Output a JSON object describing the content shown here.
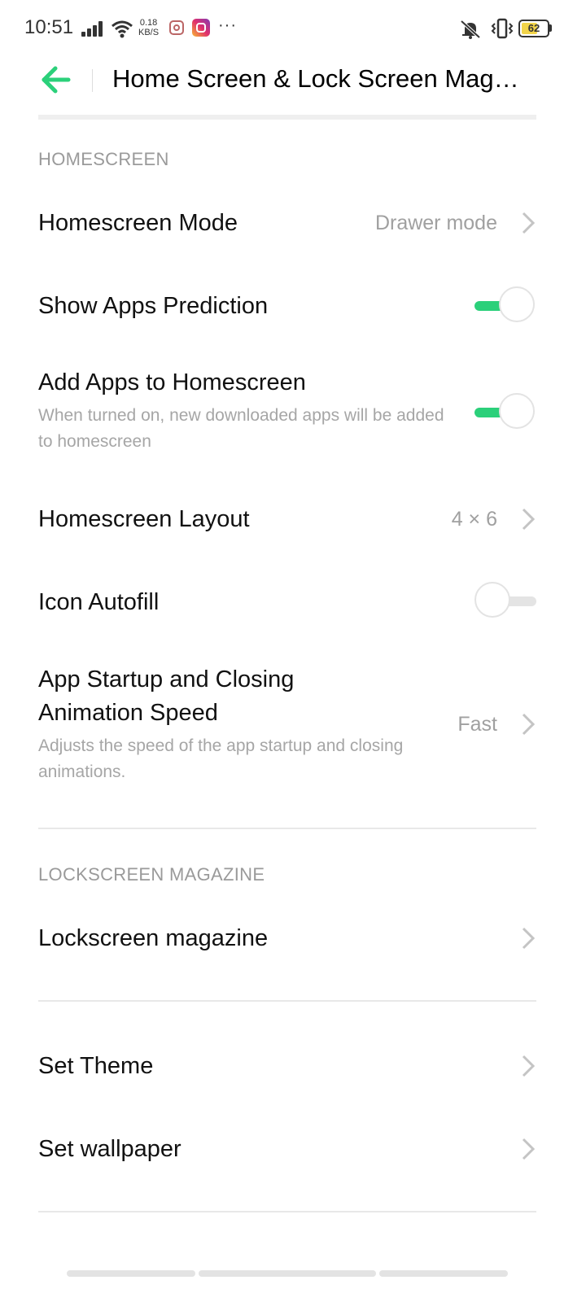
{
  "status_bar": {
    "time": "10:51",
    "net_speed_value": "0.18",
    "net_speed_unit": "KB/S",
    "more": "···",
    "battery": "62",
    "battery_level": 0.62,
    "battery_color": "#f2d44a"
  },
  "header": {
    "back_icon": "arrow-left-icon",
    "title": "Home Screen & Lock Screen Magazine",
    "accent_color": "#2bd07a"
  },
  "homescreen": {
    "section_label": "HOMESCREEN",
    "mode": {
      "label": "Homescreen Mode",
      "value": "Drawer mode"
    },
    "apps_prediction": {
      "label": "Show Apps Prediction",
      "enabled": true
    },
    "add_apps": {
      "label": "Add Apps to Homescreen",
      "description": "When turned on, new downloaded apps will be added to homescreen",
      "enabled": true
    },
    "layout": {
      "label": "Homescreen Layout",
      "value": "4 × 6"
    },
    "icon_autofill": {
      "label": "Icon Autofill",
      "enabled": false
    },
    "animation_speed": {
      "label": "App Startup and Closing Animation Speed",
      "description": "Adjusts the speed of the app startup and closing animations.",
      "value": "Fast"
    }
  },
  "lockscreen": {
    "section_label": "LOCKSCREEN MAGAZINE",
    "magazine": {
      "label": "Lockscreen magazine"
    }
  },
  "other": {
    "set_theme": {
      "label": "Set Theme"
    },
    "set_wallpaper": {
      "label": "Set wallpaper"
    }
  }
}
